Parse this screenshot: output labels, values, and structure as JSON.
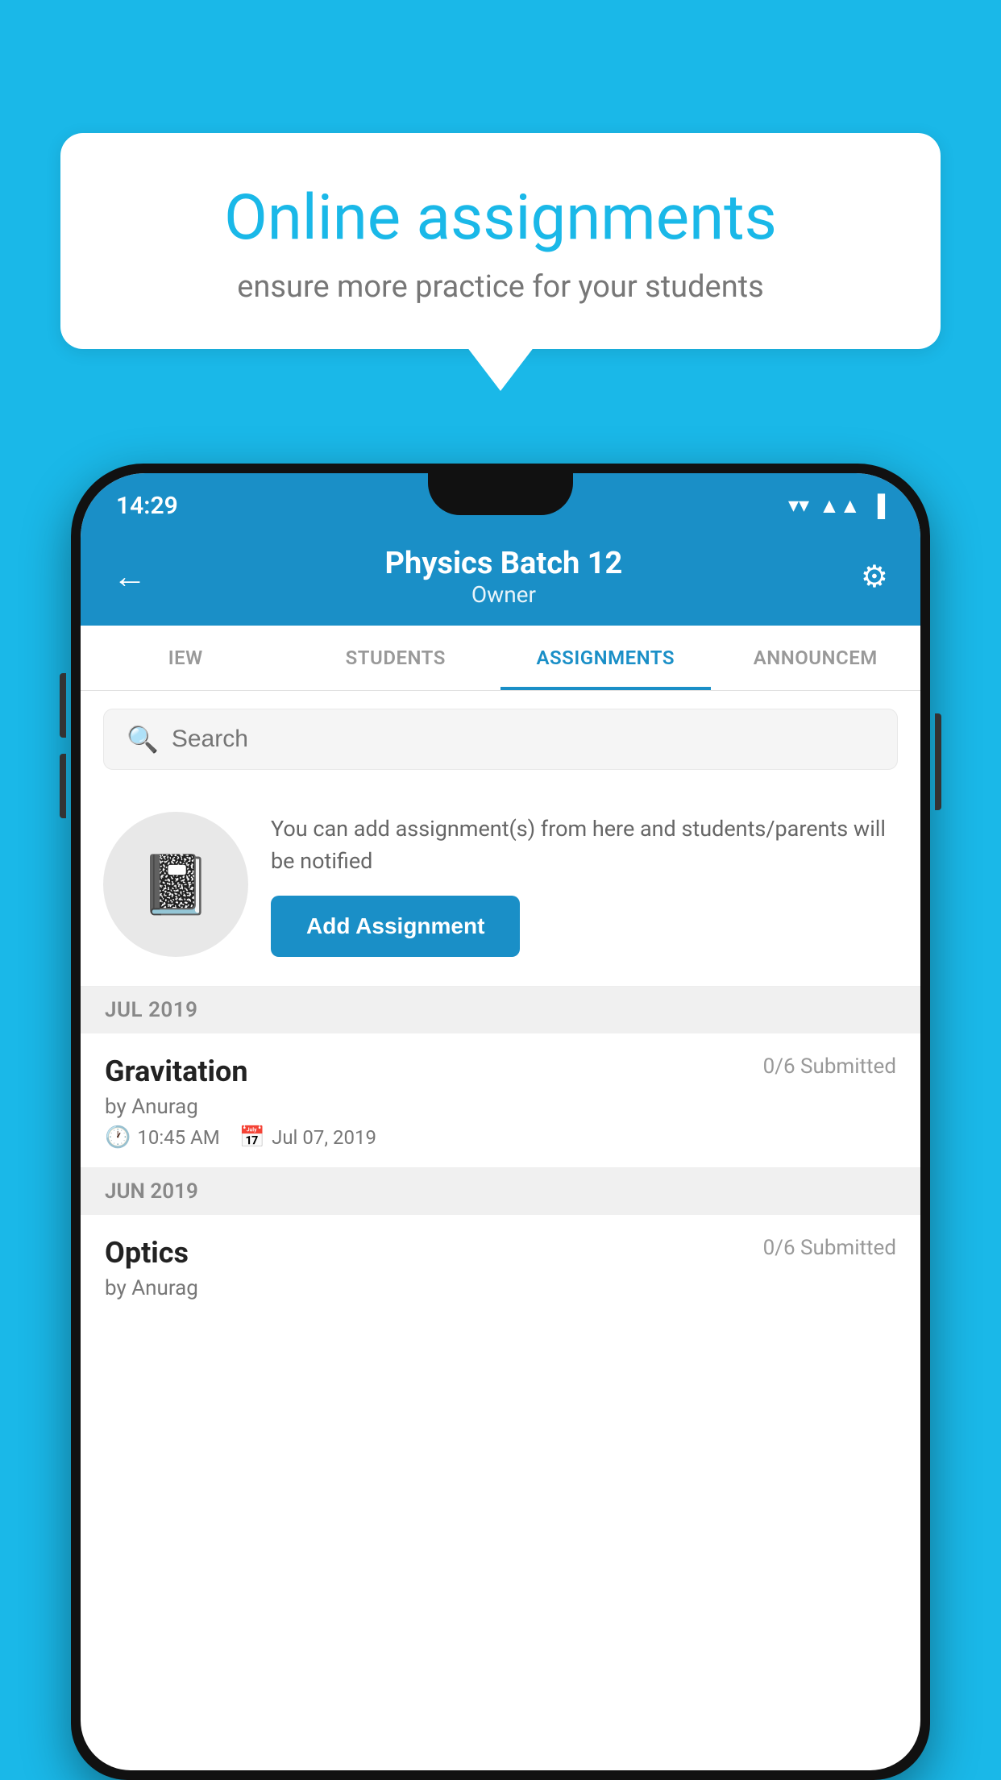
{
  "background_color": "#1ab8e8",
  "bubble": {
    "title": "Online assignments",
    "subtitle": "ensure more practice for your students"
  },
  "phone": {
    "status_bar": {
      "time": "14:29",
      "icons": [
        "wifi",
        "signal",
        "battery"
      ]
    },
    "header": {
      "title": "Physics Batch 12",
      "subtitle": "Owner",
      "back_label": "←",
      "settings_label": "⚙"
    },
    "tabs": [
      {
        "label": "IEW",
        "active": false
      },
      {
        "label": "STUDENTS",
        "active": false
      },
      {
        "label": "ASSIGNMENTS",
        "active": true
      },
      {
        "label": "ANNOUNCEM",
        "active": false
      }
    ],
    "search": {
      "placeholder": "Search"
    },
    "promo": {
      "description": "You can add assignment(s) from here and students/parents will be notified",
      "button_label": "Add Assignment"
    },
    "sections": [
      {
        "header": "JUL 2019",
        "assignments": [
          {
            "name": "Gravitation",
            "submitted": "0/6 Submitted",
            "author": "by Anurag",
            "time": "10:45 AM",
            "date": "Jul 07, 2019"
          }
        ]
      },
      {
        "header": "JUN 2019",
        "assignments": [
          {
            "name": "Optics",
            "submitted": "0/6 Submitted",
            "author": "by Anurag"
          }
        ]
      }
    ]
  }
}
